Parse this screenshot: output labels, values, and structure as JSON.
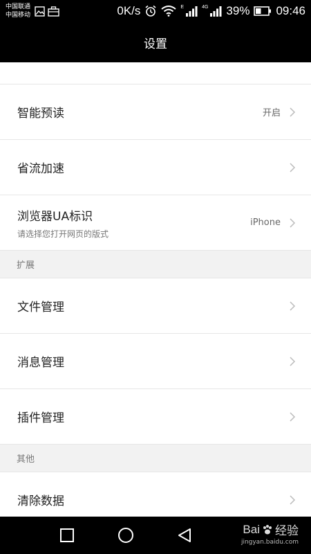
{
  "status_bar": {
    "carrier_1": "中国联通",
    "carrier_2": "中国移动",
    "speed": "0K/s",
    "net_1": "E",
    "net_2": "4G",
    "battery": "39%",
    "time": "09:46",
    "icons": [
      "image-icon",
      "briefcase-icon",
      "alarm-icon",
      "wifi-icon",
      "signal-icon",
      "signal-icon",
      "battery-icon"
    ]
  },
  "header": {
    "title": "设置"
  },
  "settings": {
    "smart_preread": {
      "title": "智能预读",
      "value": "开启"
    },
    "data_saver": {
      "title": "省流加速"
    },
    "ua": {
      "title": "浏览器UA标识",
      "subtitle": "请选择您打开网页的版式",
      "value": "iPhone"
    },
    "section_extend": "扩展",
    "file_manage": {
      "title": "文件管理"
    },
    "message_manage": {
      "title": "消息管理"
    },
    "plugin_manage": {
      "title": "插件管理"
    },
    "section_other": "其他",
    "clear_data": {
      "title": "清除数据"
    }
  },
  "watermark": {
    "brand": "Bai",
    "brand_suffix": "经验",
    "site": "jingyan.baidu.com"
  },
  "colors": {
    "background": "#f2f2f2",
    "bar": "#000000",
    "divider": "#e6e6e6",
    "text": "#222222",
    "muted": "#777777"
  }
}
